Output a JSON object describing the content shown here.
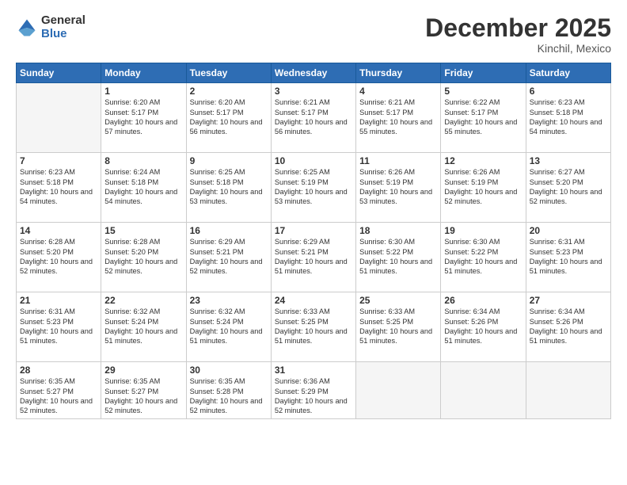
{
  "logo": {
    "general": "General",
    "blue": "Blue"
  },
  "header": {
    "month": "December 2025",
    "location": "Kinchil, Mexico"
  },
  "weekdays": [
    "Sunday",
    "Monday",
    "Tuesday",
    "Wednesday",
    "Thursday",
    "Friday",
    "Saturday"
  ],
  "weeks": [
    [
      {
        "day": "",
        "info": ""
      },
      {
        "day": "1",
        "info": "Sunrise: 6:20 AM\nSunset: 5:17 PM\nDaylight: 10 hours\nand 57 minutes."
      },
      {
        "day": "2",
        "info": "Sunrise: 6:20 AM\nSunset: 5:17 PM\nDaylight: 10 hours\nand 56 minutes."
      },
      {
        "day": "3",
        "info": "Sunrise: 6:21 AM\nSunset: 5:17 PM\nDaylight: 10 hours\nand 56 minutes."
      },
      {
        "day": "4",
        "info": "Sunrise: 6:21 AM\nSunset: 5:17 PM\nDaylight: 10 hours\nand 55 minutes."
      },
      {
        "day": "5",
        "info": "Sunrise: 6:22 AM\nSunset: 5:17 PM\nDaylight: 10 hours\nand 55 minutes."
      },
      {
        "day": "6",
        "info": "Sunrise: 6:23 AM\nSunset: 5:18 PM\nDaylight: 10 hours\nand 54 minutes."
      }
    ],
    [
      {
        "day": "7",
        "info": "Sunrise: 6:23 AM\nSunset: 5:18 PM\nDaylight: 10 hours\nand 54 minutes."
      },
      {
        "day": "8",
        "info": "Sunrise: 6:24 AM\nSunset: 5:18 PM\nDaylight: 10 hours\nand 54 minutes."
      },
      {
        "day": "9",
        "info": "Sunrise: 6:25 AM\nSunset: 5:18 PM\nDaylight: 10 hours\nand 53 minutes."
      },
      {
        "day": "10",
        "info": "Sunrise: 6:25 AM\nSunset: 5:19 PM\nDaylight: 10 hours\nand 53 minutes."
      },
      {
        "day": "11",
        "info": "Sunrise: 6:26 AM\nSunset: 5:19 PM\nDaylight: 10 hours\nand 53 minutes."
      },
      {
        "day": "12",
        "info": "Sunrise: 6:26 AM\nSunset: 5:19 PM\nDaylight: 10 hours\nand 52 minutes."
      },
      {
        "day": "13",
        "info": "Sunrise: 6:27 AM\nSunset: 5:20 PM\nDaylight: 10 hours\nand 52 minutes."
      }
    ],
    [
      {
        "day": "14",
        "info": "Sunrise: 6:28 AM\nSunset: 5:20 PM\nDaylight: 10 hours\nand 52 minutes."
      },
      {
        "day": "15",
        "info": "Sunrise: 6:28 AM\nSunset: 5:20 PM\nDaylight: 10 hours\nand 52 minutes."
      },
      {
        "day": "16",
        "info": "Sunrise: 6:29 AM\nSunset: 5:21 PM\nDaylight: 10 hours\nand 52 minutes."
      },
      {
        "day": "17",
        "info": "Sunrise: 6:29 AM\nSunset: 5:21 PM\nDaylight: 10 hours\nand 51 minutes."
      },
      {
        "day": "18",
        "info": "Sunrise: 6:30 AM\nSunset: 5:22 PM\nDaylight: 10 hours\nand 51 minutes."
      },
      {
        "day": "19",
        "info": "Sunrise: 6:30 AM\nSunset: 5:22 PM\nDaylight: 10 hours\nand 51 minutes."
      },
      {
        "day": "20",
        "info": "Sunrise: 6:31 AM\nSunset: 5:23 PM\nDaylight: 10 hours\nand 51 minutes."
      }
    ],
    [
      {
        "day": "21",
        "info": "Sunrise: 6:31 AM\nSunset: 5:23 PM\nDaylight: 10 hours\nand 51 minutes."
      },
      {
        "day": "22",
        "info": "Sunrise: 6:32 AM\nSunset: 5:24 PM\nDaylight: 10 hours\nand 51 minutes."
      },
      {
        "day": "23",
        "info": "Sunrise: 6:32 AM\nSunset: 5:24 PM\nDaylight: 10 hours\nand 51 minutes."
      },
      {
        "day": "24",
        "info": "Sunrise: 6:33 AM\nSunset: 5:25 PM\nDaylight: 10 hours\nand 51 minutes."
      },
      {
        "day": "25",
        "info": "Sunrise: 6:33 AM\nSunset: 5:25 PM\nDaylight: 10 hours\nand 51 minutes."
      },
      {
        "day": "26",
        "info": "Sunrise: 6:34 AM\nSunset: 5:26 PM\nDaylight: 10 hours\nand 51 minutes."
      },
      {
        "day": "27",
        "info": "Sunrise: 6:34 AM\nSunset: 5:26 PM\nDaylight: 10 hours\nand 51 minutes."
      }
    ],
    [
      {
        "day": "28",
        "info": "Sunrise: 6:35 AM\nSunset: 5:27 PM\nDaylight: 10 hours\nand 52 minutes."
      },
      {
        "day": "29",
        "info": "Sunrise: 6:35 AM\nSunset: 5:27 PM\nDaylight: 10 hours\nand 52 minutes."
      },
      {
        "day": "30",
        "info": "Sunrise: 6:35 AM\nSunset: 5:28 PM\nDaylight: 10 hours\nand 52 minutes."
      },
      {
        "day": "31",
        "info": "Sunrise: 6:36 AM\nSunset: 5:29 PM\nDaylight: 10 hours\nand 52 minutes."
      },
      {
        "day": "",
        "info": ""
      },
      {
        "day": "",
        "info": ""
      },
      {
        "day": "",
        "info": ""
      }
    ]
  ]
}
